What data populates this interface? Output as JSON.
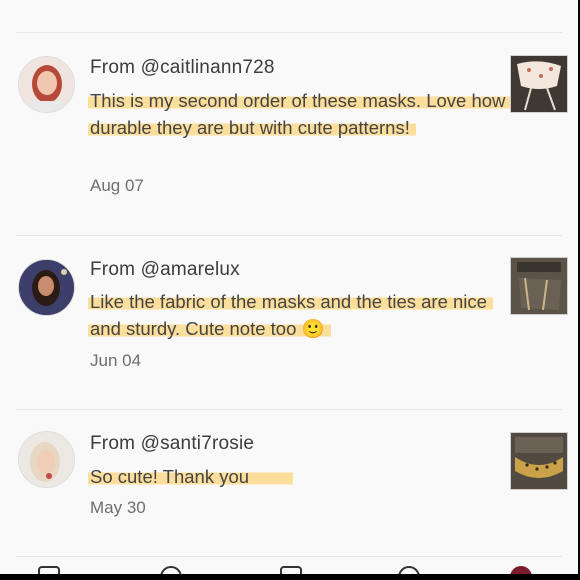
{
  "reviews": [
    {
      "author": "From @caitlinann728",
      "comment": "This is my second order of these masks. Love how durable they are but with cute patterns!",
      "date": "Aug 07"
    },
    {
      "author": "From @amarelux",
      "comment": "Like the fabric of the masks and the ties are nice and sturdy. Cute note too 🙂",
      "date": "Jun 04"
    },
    {
      "author": "From @santi7rosie",
      "comment": "So cute! Thank you",
      "date": "May 30"
    }
  ],
  "colors": {
    "highlight": "#fddA8c",
    "accent_nav": "#7a1e2e"
  },
  "bottom_nav": [
    "profile-icon",
    "search-icon",
    "shop-icon",
    "explore-icon",
    "avatar-icon"
  ]
}
